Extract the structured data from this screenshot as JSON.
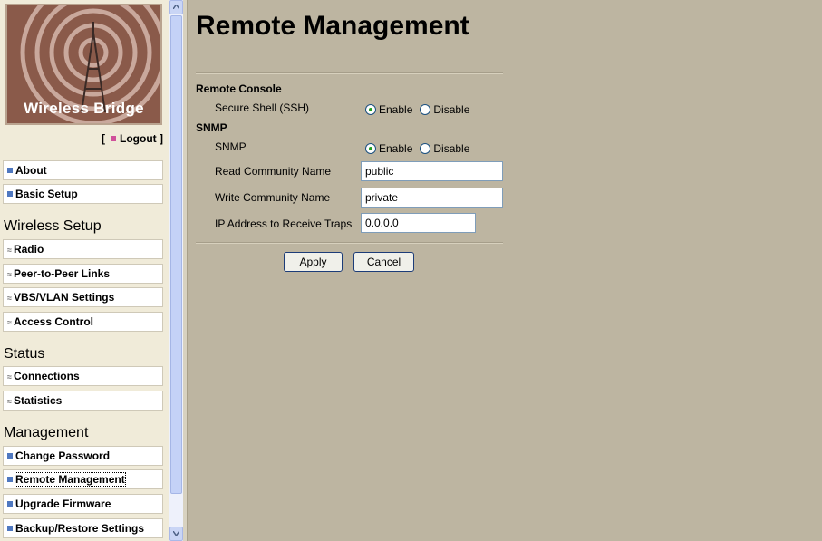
{
  "logo": {
    "text": "Wireless Bridge"
  },
  "logout": {
    "label": "Logout",
    "open": "[",
    "close": "]"
  },
  "nav": {
    "top_items": [
      {
        "label": "About"
      },
      {
        "label": "Basic Setup"
      }
    ],
    "sections": [
      {
        "heading": "Wireless Setup",
        "items": [
          {
            "label": "Radio"
          },
          {
            "label": "Peer-to-Peer Links"
          },
          {
            "label": "VBS/VLAN Settings"
          },
          {
            "label": "Access Control"
          }
        ]
      },
      {
        "heading": "Status",
        "items": [
          {
            "label": "Connections"
          },
          {
            "label": "Statistics"
          }
        ]
      },
      {
        "heading": "Management",
        "items": [
          {
            "label": "Change Password"
          },
          {
            "label": "Remote Management",
            "selected": true
          },
          {
            "label": "Upgrade Firmware"
          },
          {
            "label": "Backup/Restore Settings"
          }
        ]
      }
    ]
  },
  "page": {
    "title": "Remote Management",
    "remote_console": {
      "heading": "Remote Console",
      "ssh_label": "Secure Shell (SSH)",
      "enable_label": "Enable",
      "disable_label": "Disable",
      "selected": "Enable"
    },
    "snmp": {
      "heading": "SNMP",
      "snmp_label": "SNMP",
      "enable_label": "Enable",
      "disable_label": "Disable",
      "selected": "Enable",
      "read_community_label": "Read Community Name",
      "read_community_value": "public",
      "write_community_label": "Write Community Name",
      "write_community_value": "private",
      "trap_ip_label": "IP Address to Receive Traps",
      "trap_ip_value": "0.0.0.0"
    },
    "apply_label": "Apply",
    "cancel_label": "Cancel"
  },
  "colors": {
    "background": "#bdb5a1",
    "sidebar": "#f0ebd9",
    "logo": "#8a5a4a",
    "accent": "#4f78c0",
    "logout_marker": "#d0509a",
    "radio_checked": "#21a121"
  }
}
